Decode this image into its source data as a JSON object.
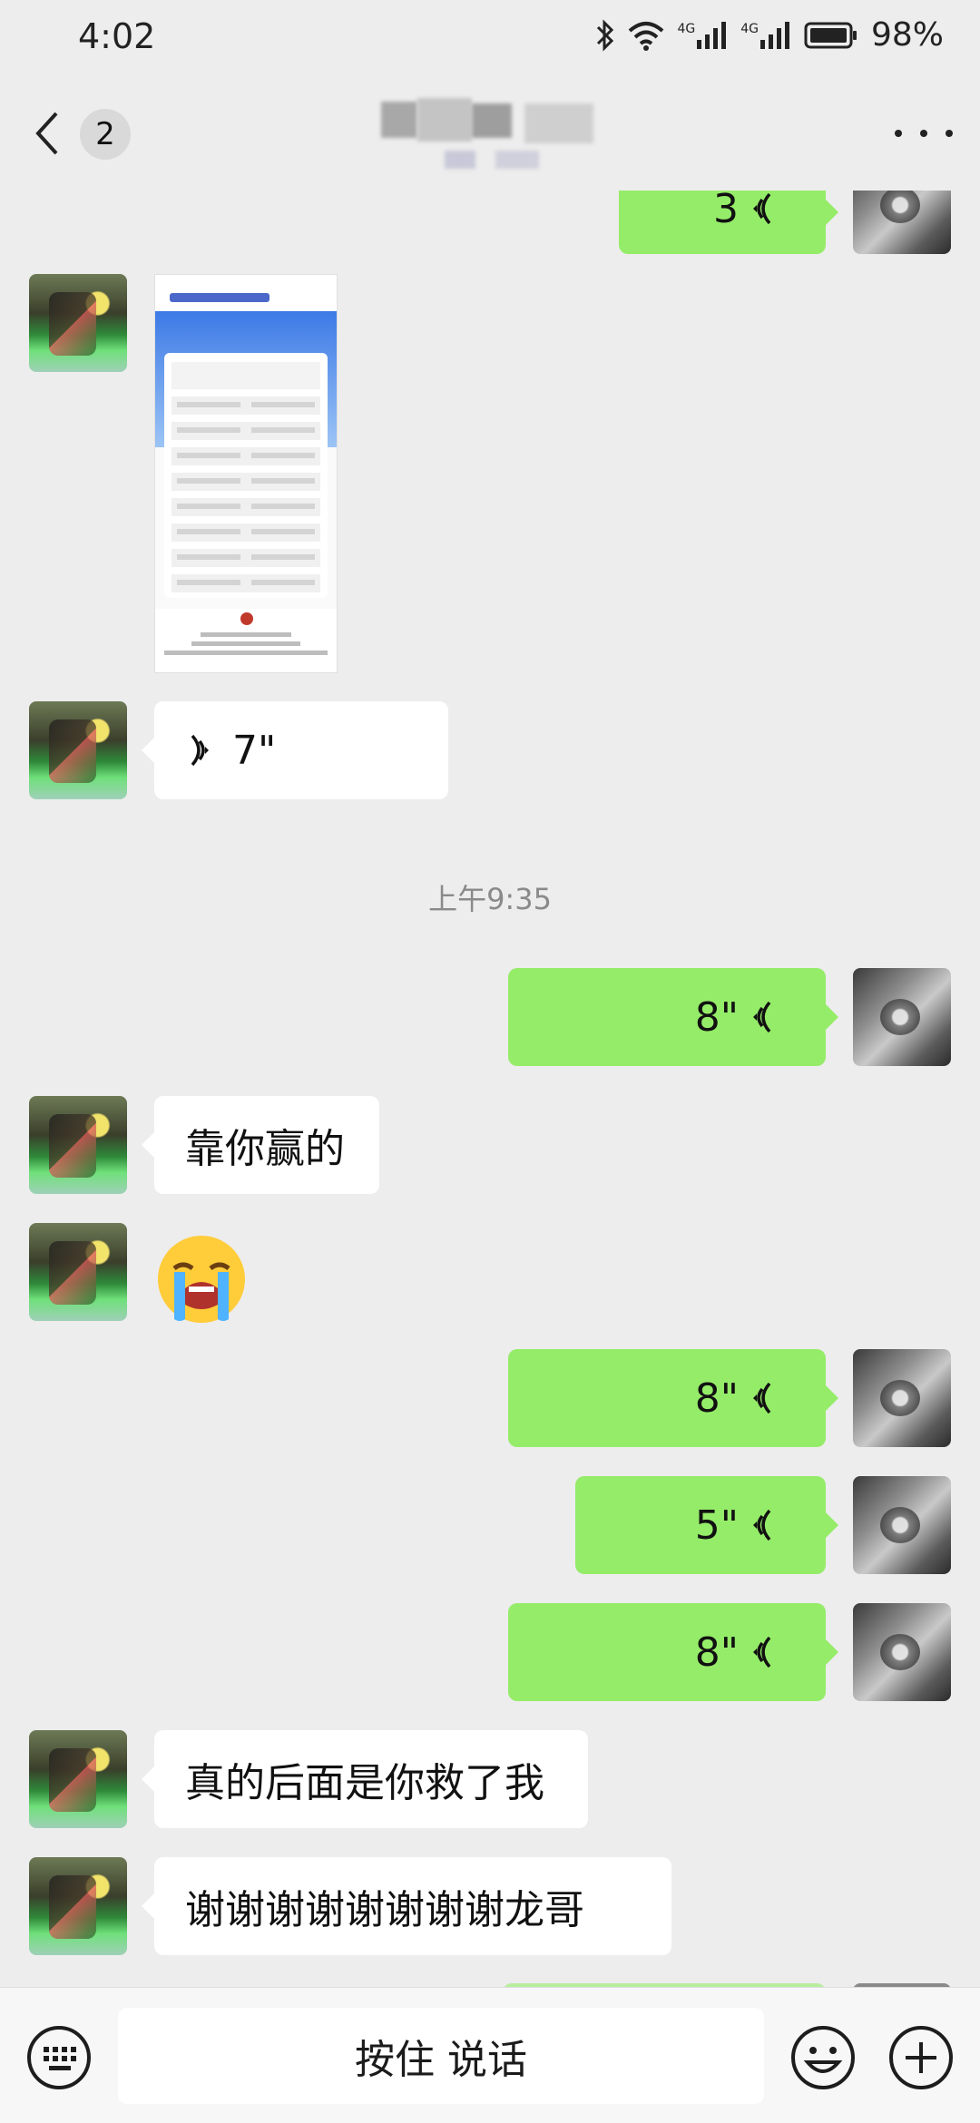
{
  "status_bar": {
    "time": "4:02",
    "network_1": "4G",
    "network_2": "4G",
    "battery": "98%"
  },
  "nav": {
    "unread_count": "2"
  },
  "timestamp": "上午9:35",
  "messages": {
    "m0": {
      "duration": "3"
    },
    "m2": {
      "duration": "7\""
    },
    "m3": {
      "duration": "8\""
    },
    "m4": {
      "text": "靠你赢的"
    },
    "m5": {
      "emoji": "loudly-crying-face"
    },
    "m6": {
      "duration": "8\""
    },
    "m7": {
      "duration": "5\""
    },
    "m8": {
      "duration": "8\""
    },
    "m9": {
      "text": "真的后面是你救了我"
    },
    "m10": {
      "text": "谢谢谢谢谢谢谢谢龙哥"
    }
  },
  "input": {
    "hold_to_talk": "按住 说话"
  },
  "colors": {
    "background": "#ededed",
    "outgoing_bubble": "#95ec69",
    "incoming_bubble": "#ffffff"
  }
}
